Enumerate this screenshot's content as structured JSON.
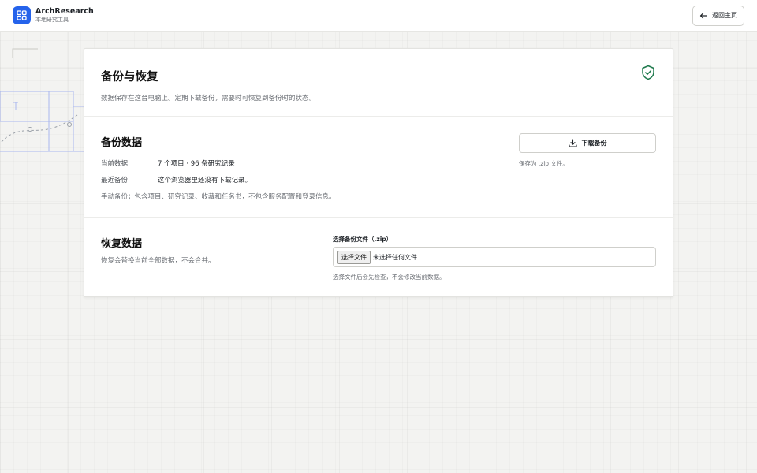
{
  "app": {
    "name": "ArchResearch",
    "subtitle": "本地研究工具",
    "back_label": "返回主页"
  },
  "colors": {
    "accent": "#2563eb",
    "success": "#1f7a4d"
  },
  "header": {
    "title": "备份与恢复",
    "description": "数据保存在这台电脑上。定期下载备份，需要时可恢复到备份时的状态。",
    "icon": "shield-check-icon"
  },
  "backup": {
    "title": "备份数据",
    "current_label": "当前数据",
    "current_value": "7 个项目 · 96 条研究记录",
    "last_label": "最近备份",
    "last_value": "这个浏览器里还没有下载记录。",
    "note": "手动备份；包含项目、研究记录、收藏和任务书，不包含服务配置和登录信息。",
    "download_label": "下载备份",
    "save_as": "保存为 .zip 文件。"
  },
  "restore": {
    "title": "恢复数据",
    "description": "恢复会替换当前全部数据，不会合并。",
    "file_label": "选择备份文件（.zip）",
    "choose_label": "选择文件",
    "file_status": "未选择任何文件",
    "hint": "选择文件后会先检查，不会修改当前数据。"
  }
}
